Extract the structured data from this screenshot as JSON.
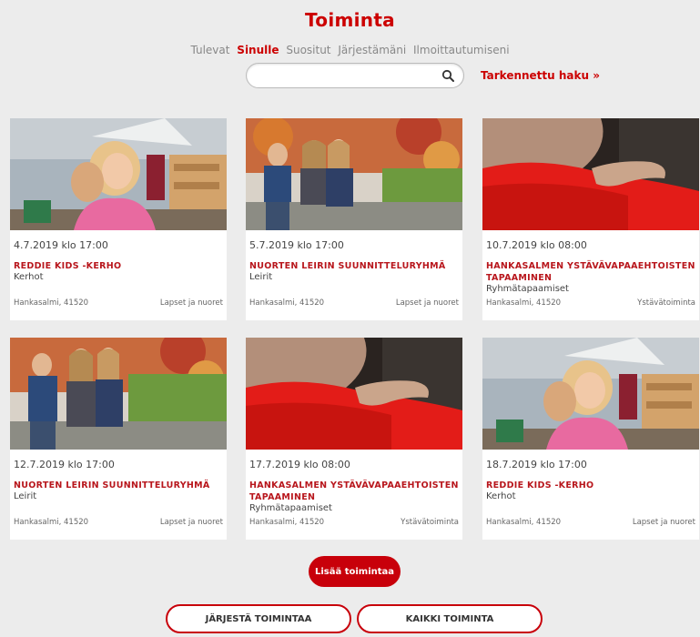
{
  "page": {
    "title": "Toiminta"
  },
  "tabs": [
    {
      "label": "Tulevat",
      "active": false
    },
    {
      "label": "Sinulle",
      "active": true
    },
    {
      "label": "Suositut",
      "active": false
    },
    {
      "label": "Järjestämäni",
      "active": false
    },
    {
      "label": "Ilmoittautumiseni",
      "active": false
    }
  ],
  "search": {
    "value": "",
    "placeholder": "",
    "advanced_label": "Tarkennettu haku »"
  },
  "cards": [
    {
      "date": "4.7.2019 klo 17:00",
      "name": "REDDIE KIDS -KERHO",
      "category": "Kerhot",
      "location": "Hankasalmi, 41520",
      "tag": "Lapset ja nuoret",
      "image": "kids-hug-photo"
    },
    {
      "date": "5.7.2019 klo 17:00",
      "name": "NUORTEN LEIRIN SUUNNITTELURYHMÄ",
      "category": "Leirit",
      "location": "Hankasalmi, 41520",
      "tag": "Lapset ja nuoret",
      "image": "youth-bench-photo"
    },
    {
      "date": "10.7.2019 klo 08:00",
      "name": "HANKASALMEN YSTÄVÄVAPAAEHTOISTEN TAPAAMINEN",
      "category": "Ryhmätapaamiset",
      "location": "Hankasalmi, 41520",
      "tag": "Ystävätoiminta",
      "image": "elderly-hand-photo"
    },
    {
      "date": "12.7.2019 klo 17:00",
      "name": "NUORTEN LEIRIN SUUNNITTELURYHMÄ",
      "category": "Leirit",
      "location": "Hankasalmi, 41520",
      "tag": "Lapset ja nuoret",
      "image": "youth-bench-photo"
    },
    {
      "date": "17.7.2019 klo 08:00",
      "name": "HANKASALMEN YSTÄVÄVAPAAEHTOISTEN TAPAAMINEN",
      "category": "Ryhmätapaamiset",
      "location": "Hankasalmi, 41520",
      "tag": "Ystävätoiminta",
      "image": "elderly-hand-photo"
    },
    {
      "date": "18.7.2019 klo 17:00",
      "name": "REDDIE KIDS -KERHO",
      "category": "Kerhot",
      "location": "Hankasalmi, 41520",
      "tag": "Lapset ja nuoret",
      "image": "kids-hug-photo"
    }
  ],
  "buttons": {
    "more": "Lisää toimintaa",
    "organize": "JÄRJESTÄ TOIMINTAA",
    "all": "KAIKKI TOIMINTA"
  },
  "colors": {
    "accent": "#cc0000",
    "background": "#ececec"
  }
}
